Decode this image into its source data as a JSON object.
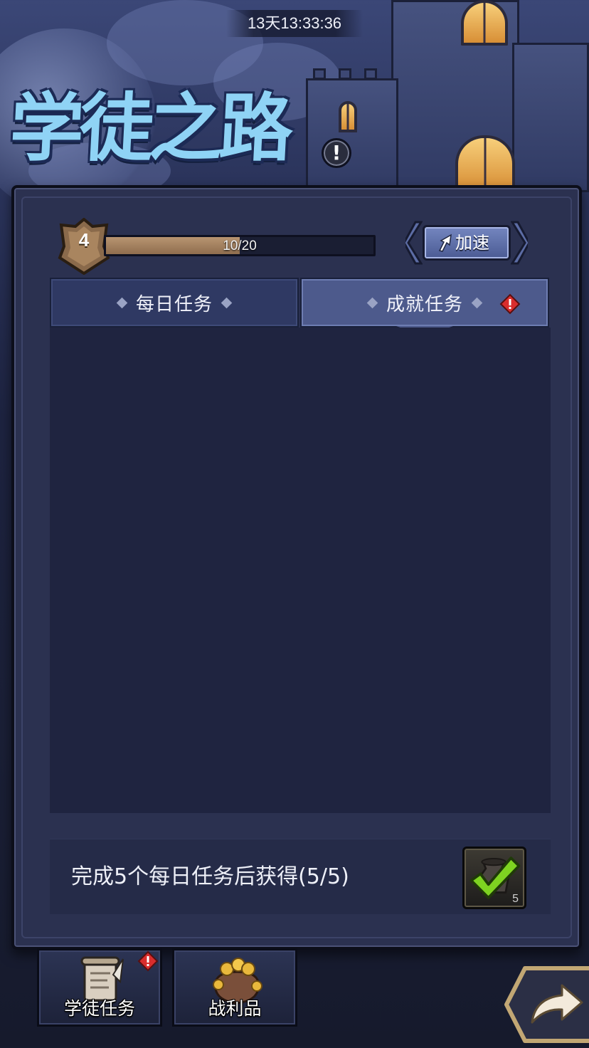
{
  "header": {
    "timer": "13天13:33:36",
    "title": "学徒之路"
  },
  "progress": {
    "level": "4",
    "xp_text": "10/20",
    "xp_fraction": 0.5,
    "speed_button_label": "加速"
  },
  "tabs": [
    {
      "label": "每日任务",
      "selected": false,
      "alert": false
    },
    {
      "label": "成就任务",
      "selected": true,
      "alert": true
    }
  ],
  "reward": {
    "text": "完成5个每日任务后获得(5/5)",
    "item_count": "5",
    "completed": true
  },
  "bottom_buttons": [
    {
      "label": "学徒任务",
      "icon": "scroll-icon",
      "alert": true
    },
    {
      "label": "战利品",
      "icon": "treasure-bag-icon",
      "alert": false
    }
  ],
  "colors": {
    "panel": "#2b3150",
    "tab_selected": "#4d5a8c",
    "tab_unselected": "#2f3963",
    "xp_fill": "#b89571",
    "alert_red": "#d92d2d",
    "check_green": "#7ed321"
  }
}
